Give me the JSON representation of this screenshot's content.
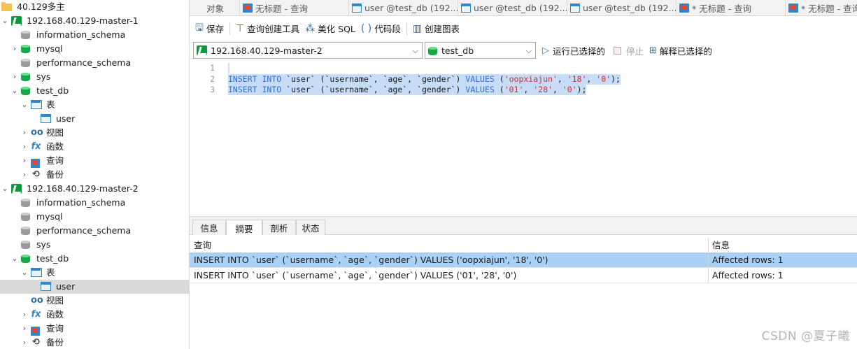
{
  "sidebar": {
    "nodes": [
      {
        "label": "40.129多主",
        "icon": "folder-icon",
        "expander": "",
        "selected": false
      },
      {
        "label": "192.168.40.129-master-1",
        "icon": "mysql-connection-icon",
        "expander": "⌄",
        "selected": false
      },
      {
        "label": "information_schema",
        "icon": "database-icon-gray",
        "expander": "",
        "selected": false
      },
      {
        "label": "mysql",
        "icon": "database-icon",
        "expander": "›",
        "selected": false
      },
      {
        "label": "performance_schema",
        "icon": "database-icon-gray",
        "expander": "",
        "selected": false
      },
      {
        "label": "sys",
        "icon": "database-icon",
        "expander": "›",
        "selected": false
      },
      {
        "label": "test_db",
        "icon": "database-icon",
        "expander": "⌄",
        "selected": false
      },
      {
        "label": "表",
        "icon": "table-folder-icon",
        "expander": "⌄",
        "selected": false
      },
      {
        "label": "user",
        "icon": "table-icon",
        "expander": "",
        "selected": false
      },
      {
        "label": "视图",
        "icon": "view-icon",
        "expander": "›",
        "selected": false
      },
      {
        "label": "函数",
        "icon": "function-icon",
        "expander": "›",
        "selected": false
      },
      {
        "label": "查询",
        "icon": "query-icon",
        "expander": "›",
        "selected": false
      },
      {
        "label": "备份",
        "icon": "backup-icon",
        "expander": "›",
        "selected": false
      },
      {
        "label": "192.168.40.129-master-2",
        "icon": "mysql-connection-icon",
        "expander": "⌄",
        "selected": false
      },
      {
        "label": "information_schema",
        "icon": "database-icon-gray",
        "expander": "",
        "selected": false
      },
      {
        "label": "mysql",
        "icon": "database-icon-gray",
        "expander": "",
        "selected": false
      },
      {
        "label": "performance_schema",
        "icon": "database-icon-gray",
        "expander": "",
        "selected": false
      },
      {
        "label": "sys",
        "icon": "database-icon-gray",
        "expander": "",
        "selected": false
      },
      {
        "label": "test_db",
        "icon": "database-icon",
        "expander": "⌄",
        "selected": false
      },
      {
        "label": "表",
        "icon": "table-folder-icon",
        "expander": "⌄",
        "selected": false
      },
      {
        "label": "user",
        "icon": "table-icon",
        "expander": "",
        "selected": true
      },
      {
        "label": "视图",
        "icon": "view-icon",
        "expander": "",
        "selected": false
      },
      {
        "label": "函数",
        "icon": "function-icon",
        "expander": "›",
        "selected": false
      },
      {
        "label": "查询",
        "icon": "query-icon",
        "expander": "›",
        "selected": false
      },
      {
        "label": "备份",
        "icon": "backup-icon",
        "expander": "›",
        "selected": false
      }
    ]
  },
  "tabs": [
    {
      "label": "对象",
      "icon": ""
    },
    {
      "label": "无标题 - 查询",
      "icon": "query-icon"
    },
    {
      "label": "user @test_db (192....",
      "icon": "table-icon"
    },
    {
      "label": "user @test_db (192....",
      "icon": "table-icon"
    },
    {
      "label": "user @test_db (192....",
      "icon": "table-icon"
    },
    {
      "label": "* 无标题 - 查询",
      "icon": "query-icon"
    },
    {
      "label": "* 无标题 - 查询",
      "icon": "query-icon"
    }
  ],
  "toolbar": {
    "save": "保存",
    "query_builder": "查询创建工具",
    "beautify": "美化 SQL",
    "code_snippet": "代码段",
    "create_chart": "创建图表"
  },
  "connection_bar": {
    "connection": "192.168.40.129-master-2",
    "database": "test_db",
    "run_selected": "运行已选择的",
    "stop": "停止",
    "explain_selected": "解释已选择的"
  },
  "editor": {
    "line_numbers": [
      "1",
      "2",
      "3"
    ],
    "lines": [
      [],
      [
        {
          "t": "INSERT INTO",
          "c": "kw"
        },
        {
          "t": " `user` (`username`, `age`, `gender`) ",
          "c": "id"
        },
        {
          "t": "VALUES",
          "c": "kw"
        },
        {
          "t": " (",
          "c": "id"
        },
        {
          "t": "'oopxiajun'",
          "c": "str"
        },
        {
          "t": ", ",
          "c": "id"
        },
        {
          "t": "'18'",
          "c": "str"
        },
        {
          "t": ", ",
          "c": "id"
        },
        {
          "t": "'0'",
          "c": "str"
        },
        {
          "t": ");",
          "c": "id"
        }
      ],
      [
        {
          "t": "INSERT INTO",
          "c": "kw"
        },
        {
          "t": " `user` (`username`, `age`, `gender`) ",
          "c": "id"
        },
        {
          "t": "VALUES",
          "c": "kw"
        },
        {
          "t": " (",
          "c": "id"
        },
        {
          "t": "'01'",
          "c": "str"
        },
        {
          "t": ", ",
          "c": "id"
        },
        {
          "t": "'28'",
          "c": "str"
        },
        {
          "t": ", ",
          "c": "id"
        },
        {
          "t": "'0'",
          "c": "str"
        },
        {
          "t": ");",
          "c": "id"
        }
      ]
    ]
  },
  "result_tabs": [
    {
      "label": "信息",
      "active": false
    },
    {
      "label": "摘要",
      "active": true
    },
    {
      "label": "剖析",
      "active": false
    },
    {
      "label": "状态",
      "active": false
    }
  ],
  "result_grid": {
    "columns": [
      "查询",
      "信息"
    ],
    "rows": [
      {
        "query": "INSERT INTO `user` (`username`, `age`, `gender`) VALUES ('oopxiajun', '18', '0')",
        "info": "Affected rows: 1",
        "selected": true
      },
      {
        "query": "INSERT INTO `user` (`username`, `age`, `gender`) VALUES ('01', '28', '0')",
        "info": "Affected rows: 1",
        "selected": false
      }
    ]
  },
  "watermark": "CSDN @夏子曦",
  "colors": {
    "accent": "#2f86c9",
    "selection": "#a9d0f5",
    "keyword": "#2f6ed6",
    "string": "#d22d2d"
  }
}
